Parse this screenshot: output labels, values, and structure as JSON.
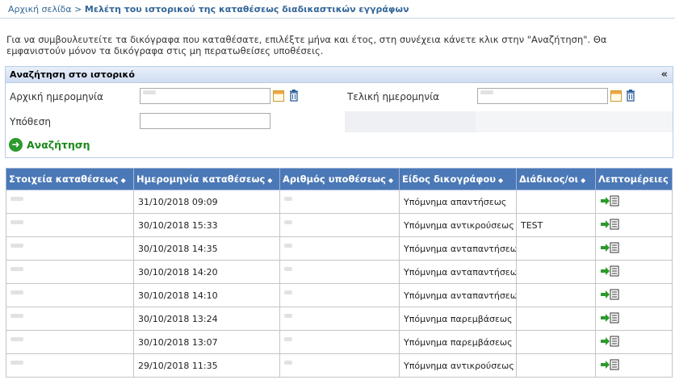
{
  "breadcrumb": {
    "home": "Αρχική σελίδα",
    "separator": ">",
    "current": "Μελέτη του ιστορικού της καταθέσεως διαδικαστικών εγγράφων"
  },
  "intro_text": "Για να συμβουλευτείτε τα δικόγραφα που καταθέσατε, επιλέξτε μήνα και έτος, στη συνέχεια κάνετε κλικ στην \"Αναζήτηση\". Θα εμφανιστούν μόνον τα δικόγραφα στις μη περατωθείσες υποθέσεις.",
  "search_panel": {
    "title": "Αναζήτηση στο ιστορικό",
    "collapse_label": "«",
    "start_date_label": "Αρχική ημερομηνία",
    "end_date_label": "Τελική ημερομηνία",
    "case_label": "Υπόθεση",
    "search_button": "Αναζήτηση"
  },
  "table": {
    "columns": [
      "Στοιχεία καταθέσεως",
      "Ημερομηνία καταθέσεως",
      "Αριθμός υποθέσεως",
      "Είδος δικογράφου",
      "Διάδικος/οι",
      "Λεπτομέρειες"
    ],
    "rows": [
      {
        "date": "31/10/2018 09:09",
        "doc_type": "Υπόμνημα απαντήσεως",
        "party": ""
      },
      {
        "date": "30/10/2018 15:33",
        "doc_type": "Υπόμνημα αντικρούσεως",
        "party": "TEST"
      },
      {
        "date": "30/10/2018 14:35",
        "doc_type": "Υπόμνημα ανταπαντήσεως",
        "party": ""
      },
      {
        "date": "30/10/2018 14:20",
        "doc_type": "Υπόμνημα ανταπαντήσεως",
        "party": ""
      },
      {
        "date": "30/10/2018 14:10",
        "doc_type": "Υπόμνημα ανταπαντήσεως",
        "party": ""
      },
      {
        "date": "30/10/2018 13:24",
        "doc_type": "Υπόμνημα παρεμβάσεως",
        "party": ""
      },
      {
        "date": "30/10/2018 13:07",
        "doc_type": "Υπόμνημα παρεμβάσεως",
        "party": ""
      },
      {
        "date": "29/10/2018 11:35",
        "doc_type": "Υπόμνημα αντικρούσεως",
        "party": ""
      }
    ]
  },
  "colors": {
    "header_blue": "#4b78b6",
    "link_blue": "#336699",
    "action_green": "#2c9a2c"
  },
  "icons": {
    "calendar": "calendar-icon",
    "trash": "trash-icon",
    "search": "arrow-right-circle-icon",
    "sort": "sort-icon",
    "details": "document-arrow-icon"
  }
}
